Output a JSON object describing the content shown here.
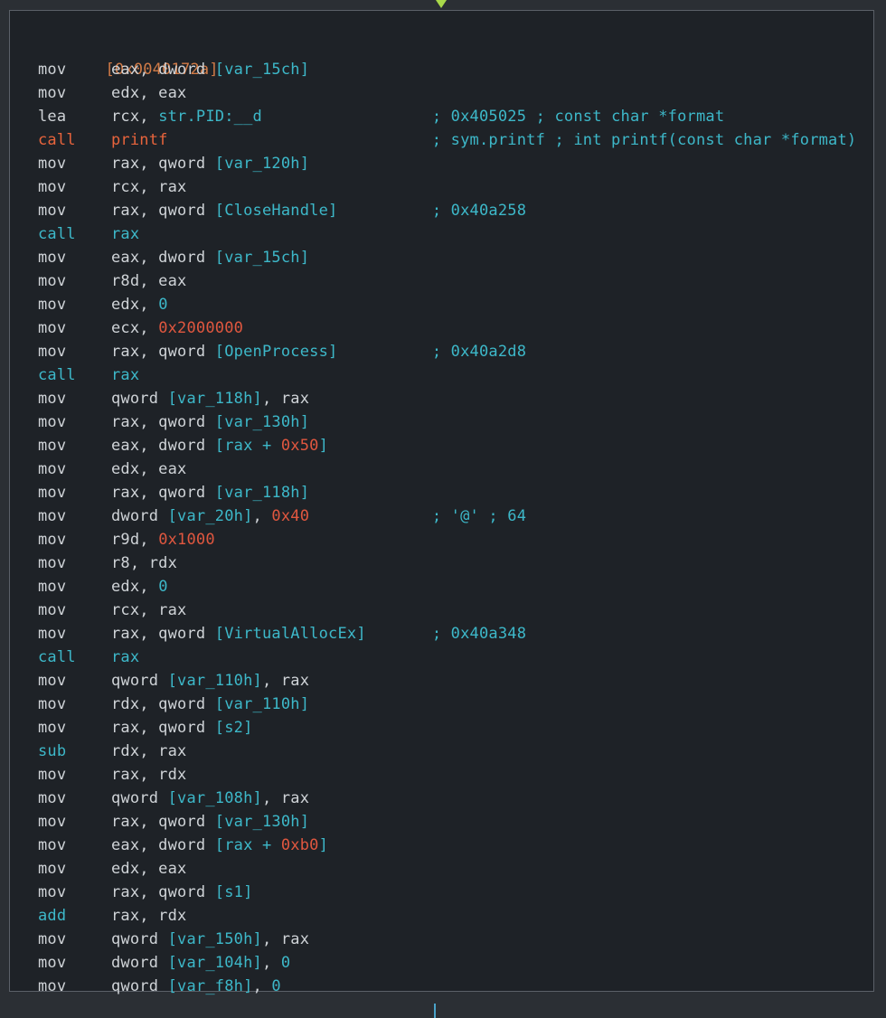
{
  "block": {
    "address": "[0x0040172a]",
    "lines": [
      {
        "mnemonic": "mov",
        "kind": "mov",
        "ops": [
          [
            "txt",
            "eax, dword "
          ],
          [
            "br",
            "[var_15ch]"
          ]
        ],
        "comment": ""
      },
      {
        "mnemonic": "mov",
        "kind": "mov",
        "ops": [
          [
            "txt",
            "edx, eax"
          ]
        ],
        "comment": ""
      },
      {
        "mnemonic": "lea",
        "kind": "lea",
        "ops": [
          [
            "txt",
            "rcx, "
          ],
          [
            "str",
            "str.PID:__d"
          ]
        ],
        "comment": "; 0x405025 ; const char *format"
      },
      {
        "mnemonic": "call",
        "kind": "call-ext",
        "ops": [
          [
            "sym",
            "printf"
          ]
        ],
        "comment": "; sym.printf ; int printf(const char *format)"
      },
      {
        "mnemonic": "mov",
        "kind": "mov",
        "ops": [
          [
            "txt",
            "rax, qword "
          ],
          [
            "br",
            "[var_120h]"
          ]
        ],
        "comment": ""
      },
      {
        "mnemonic": "mov",
        "kind": "mov",
        "ops": [
          [
            "txt",
            "rcx, rax"
          ]
        ],
        "comment": ""
      },
      {
        "mnemonic": "mov",
        "kind": "mov",
        "ops": [
          [
            "txt",
            "rax, qword "
          ],
          [
            "br",
            "[CloseHandle]"
          ]
        ],
        "comment": "; 0x40a258"
      },
      {
        "mnemonic": "call",
        "kind": "call",
        "ops": [
          [
            "br",
            "rax"
          ]
        ],
        "comment": ""
      },
      {
        "mnemonic": "mov",
        "kind": "mov",
        "ops": [
          [
            "txt",
            "eax, dword "
          ],
          [
            "br",
            "[var_15ch]"
          ]
        ],
        "comment": ""
      },
      {
        "mnemonic": "mov",
        "kind": "mov",
        "ops": [
          [
            "txt",
            "r8d, eax"
          ]
        ],
        "comment": ""
      },
      {
        "mnemonic": "mov",
        "kind": "mov",
        "ops": [
          [
            "txt",
            "edx, "
          ],
          [
            "zero",
            "0"
          ]
        ],
        "comment": ""
      },
      {
        "mnemonic": "mov",
        "kind": "mov",
        "ops": [
          [
            "txt",
            "ecx, "
          ],
          [
            "num",
            "0x2000000"
          ]
        ],
        "comment": ""
      },
      {
        "mnemonic": "mov",
        "kind": "mov",
        "ops": [
          [
            "txt",
            "rax, qword "
          ],
          [
            "br",
            "[OpenProcess]"
          ]
        ],
        "comment": "; 0x40a2d8"
      },
      {
        "mnemonic": "call",
        "kind": "call",
        "ops": [
          [
            "br",
            "rax"
          ]
        ],
        "comment": ""
      },
      {
        "mnemonic": "mov",
        "kind": "mov",
        "ops": [
          [
            "txt",
            "qword "
          ],
          [
            "br",
            "[var_118h]"
          ],
          [
            "txt",
            ", rax"
          ]
        ],
        "comment": ""
      },
      {
        "mnemonic": "mov",
        "kind": "mov",
        "ops": [
          [
            "txt",
            "rax, qword "
          ],
          [
            "br",
            "[var_130h]"
          ]
        ],
        "comment": ""
      },
      {
        "mnemonic": "mov",
        "kind": "mov",
        "ops": [
          [
            "txt",
            "eax, dword "
          ],
          [
            "br",
            "[rax + "
          ],
          [
            "num",
            "0x50"
          ],
          [
            "br",
            "]"
          ]
        ],
        "comment": ""
      },
      {
        "mnemonic": "mov",
        "kind": "mov",
        "ops": [
          [
            "txt",
            "edx, eax"
          ]
        ],
        "comment": ""
      },
      {
        "mnemonic": "mov",
        "kind": "mov",
        "ops": [
          [
            "txt",
            "rax, qword "
          ],
          [
            "br",
            "[var_118h]"
          ]
        ],
        "comment": ""
      },
      {
        "mnemonic": "mov",
        "kind": "mov",
        "ops": [
          [
            "txt",
            "dword "
          ],
          [
            "br",
            "[var_20h]"
          ],
          [
            "txt",
            ", "
          ],
          [
            "num",
            "0x40"
          ]
        ],
        "comment": "; '@' ; 64"
      },
      {
        "mnemonic": "mov",
        "kind": "mov",
        "ops": [
          [
            "txt",
            "r9d, "
          ],
          [
            "num",
            "0x1000"
          ]
        ],
        "comment": ""
      },
      {
        "mnemonic": "mov",
        "kind": "mov",
        "ops": [
          [
            "txt",
            "r8, rdx"
          ]
        ],
        "comment": ""
      },
      {
        "mnemonic": "mov",
        "kind": "mov",
        "ops": [
          [
            "txt",
            "edx, "
          ],
          [
            "zero",
            "0"
          ]
        ],
        "comment": ""
      },
      {
        "mnemonic": "mov",
        "kind": "mov",
        "ops": [
          [
            "txt",
            "rcx, rax"
          ]
        ],
        "comment": ""
      },
      {
        "mnemonic": "mov",
        "kind": "mov",
        "ops": [
          [
            "txt",
            "rax, qword "
          ],
          [
            "br",
            "[VirtualAllocEx]"
          ]
        ],
        "comment": "; 0x40a348"
      },
      {
        "mnemonic": "call",
        "kind": "call",
        "ops": [
          [
            "br",
            "rax"
          ]
        ],
        "comment": ""
      },
      {
        "mnemonic": "mov",
        "kind": "mov",
        "ops": [
          [
            "txt",
            "qword "
          ],
          [
            "br",
            "[var_110h]"
          ],
          [
            "txt",
            ", rax"
          ]
        ],
        "comment": ""
      },
      {
        "mnemonic": "mov",
        "kind": "mov",
        "ops": [
          [
            "txt",
            "rdx, qword "
          ],
          [
            "br",
            "[var_110h]"
          ]
        ],
        "comment": ""
      },
      {
        "mnemonic": "mov",
        "kind": "mov",
        "ops": [
          [
            "txt",
            "rax, qword "
          ],
          [
            "br",
            "[s2]"
          ]
        ],
        "comment": ""
      },
      {
        "mnemonic": "sub",
        "kind": "sub",
        "ops": [
          [
            "txt",
            "rdx, rax"
          ]
        ],
        "comment": ""
      },
      {
        "mnemonic": "mov",
        "kind": "mov",
        "ops": [
          [
            "txt",
            "rax, rdx"
          ]
        ],
        "comment": ""
      },
      {
        "mnemonic": "mov",
        "kind": "mov",
        "ops": [
          [
            "txt",
            "qword "
          ],
          [
            "br",
            "[var_108h]"
          ],
          [
            "txt",
            ", rax"
          ]
        ],
        "comment": ""
      },
      {
        "mnemonic": "mov",
        "kind": "mov",
        "ops": [
          [
            "txt",
            "rax, qword "
          ],
          [
            "br",
            "[var_130h]"
          ]
        ],
        "comment": ""
      },
      {
        "mnemonic": "mov",
        "kind": "mov",
        "ops": [
          [
            "txt",
            "eax, dword "
          ],
          [
            "br",
            "[rax + "
          ],
          [
            "num",
            "0xb0"
          ],
          [
            "br",
            "]"
          ]
        ],
        "comment": ""
      },
      {
        "mnemonic": "mov",
        "kind": "mov",
        "ops": [
          [
            "txt",
            "edx, eax"
          ]
        ],
        "comment": ""
      },
      {
        "mnemonic": "mov",
        "kind": "mov",
        "ops": [
          [
            "txt",
            "rax, qword "
          ],
          [
            "br",
            "[s1]"
          ]
        ],
        "comment": ""
      },
      {
        "mnemonic": "add",
        "kind": "add",
        "ops": [
          [
            "txt",
            "rax, rdx"
          ]
        ],
        "comment": ""
      },
      {
        "mnemonic": "mov",
        "kind": "mov",
        "ops": [
          [
            "txt",
            "qword "
          ],
          [
            "br",
            "[var_150h]"
          ],
          [
            "txt",
            ", rax"
          ]
        ],
        "comment": ""
      },
      {
        "mnemonic": "mov",
        "kind": "mov",
        "ops": [
          [
            "txt",
            "dword "
          ],
          [
            "br",
            "[var_104h]"
          ],
          [
            "txt",
            ", "
          ],
          [
            "zero",
            "0"
          ]
        ],
        "comment": ""
      },
      {
        "mnemonic": "mov",
        "kind": "mov",
        "ops": [
          [
            "txt",
            "qword "
          ],
          [
            "br",
            "[var_f8h]"
          ],
          [
            "txt",
            ", "
          ],
          [
            "zero",
            "0"
          ]
        ],
        "comment": ""
      }
    ]
  }
}
